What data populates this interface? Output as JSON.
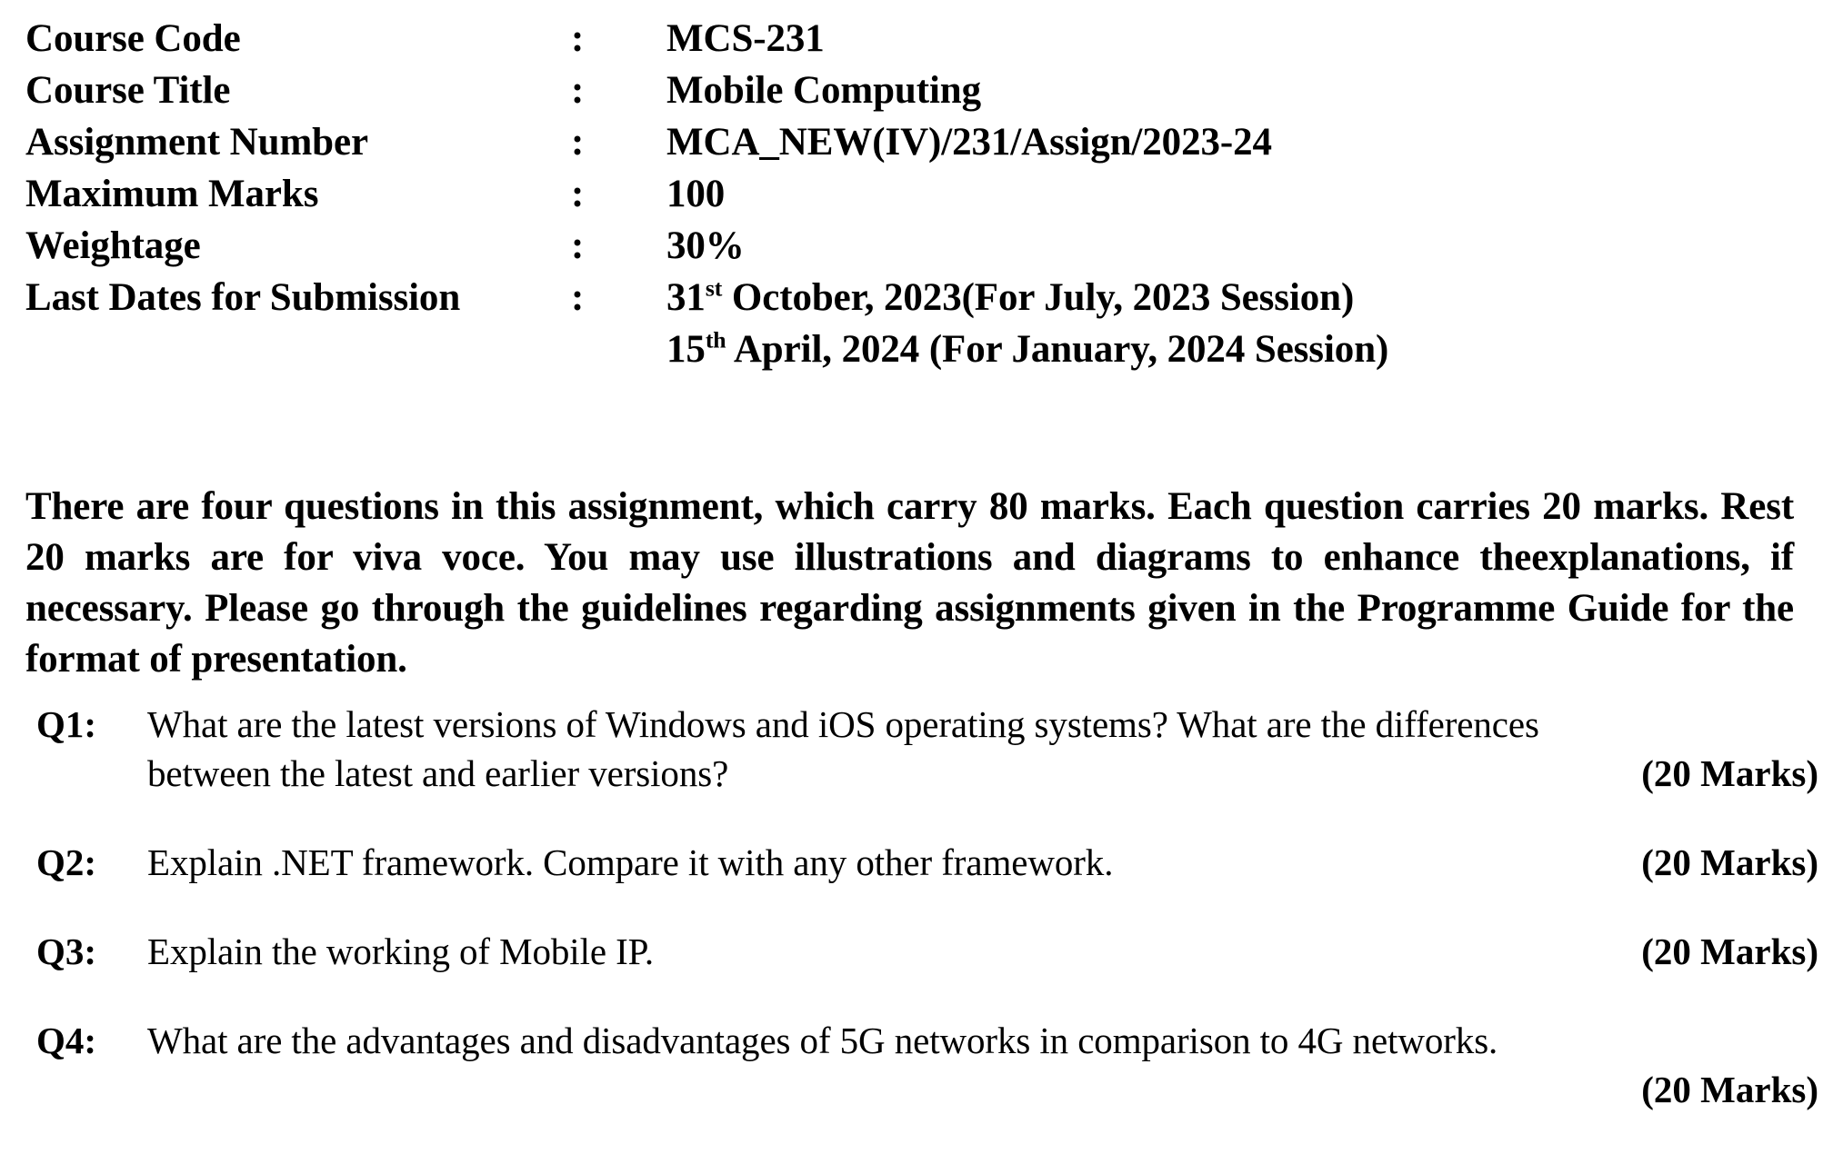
{
  "header": {
    "rows": [
      {
        "label": "Course Code",
        "value": "MCS-231"
      },
      {
        "label": "Course Title",
        "value": "Mobile Computing"
      },
      {
        "label": "Assignment Number",
        "value": "MCA_NEW(IV)/231/Assign/2023-24"
      },
      {
        "label": "Maximum Marks",
        "value": "100"
      },
      {
        "label": "Weightage",
        "value": "30%"
      }
    ],
    "submission": {
      "label": "Last Dates for Submission",
      "colon": ":",
      "date1": {
        "day": "31",
        "ordinal": "st",
        "rest": " October, 2023(For July, 2023 Session)"
      },
      "date2": {
        "day": "15",
        "ordinal": "th",
        "rest": " April, 2024 (For January, 2024 Session)"
      }
    },
    "colon": ":"
  },
  "instructions": "There are four questions in this assignment, which carry 80 marks. Each question carries 20 marks. Rest 20 marks are for viva voce. You may use illustrations and diagrams to enhance theexplanations, if necessary. Please go through the guidelines regarding assignments given in the Programme Guide for the format of presentation.",
  "questions": [
    {
      "label": "Q1:",
      "text": "What are the latest versions of Windows and iOS operating systems? What are the differences between the latest and earlier versions?",
      "line1": "What are the latest versions of Windows and iOS operating systems? What are the differences",
      "line2": "between the latest and earlier versions?",
      "marks": "(20 Marks)"
    },
    {
      "label": "Q2:",
      "text": "Explain .NET framework. Compare it with any other framework.",
      "marks": "(20 Marks)"
    },
    {
      "label": "Q3:",
      "text": "Explain the working of Mobile IP.",
      "marks": "(20 Marks)"
    },
    {
      "label": "Q4:",
      "text": "What are the advantages and disadvantages of 5G networks in comparison to 4G networks.",
      "marks": "(20 Marks)"
    }
  ]
}
